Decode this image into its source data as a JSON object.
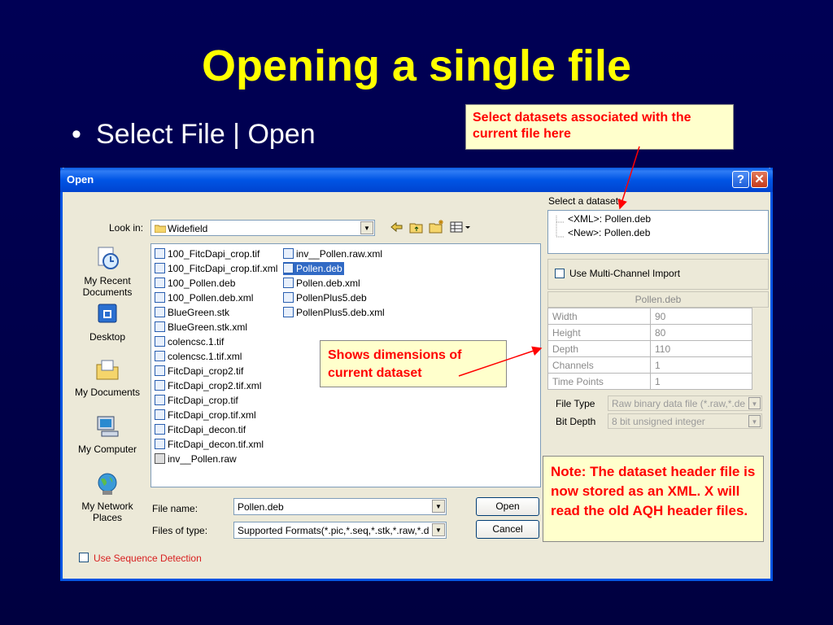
{
  "slide": {
    "title": "Opening a single file",
    "bullet": "Select File | Open"
  },
  "callouts": {
    "select_datasets": "Select datasets associated with the current file here",
    "dimensions": "Shows dimensions of current dataset",
    "note": "Note: The dataset header file is  now stored as an XML.  X will read the old AQH header files."
  },
  "dialog": {
    "title": "Open",
    "help_button": "?",
    "close_button": "✕",
    "look_in_label": "Look in:",
    "look_in_value": "Widefield",
    "places": [
      "My Recent Documents",
      "Desktop",
      "My Documents",
      "My Computer",
      "My Network Places"
    ],
    "files_col1": [
      "100_FitcDapi_crop.tif",
      "100_FitcDapi_crop.tif.xml",
      "100_Pollen.deb",
      "100_Pollen.deb.xml",
      "BlueGreen.stk",
      "BlueGreen.stk.xml",
      "colencsc.1.tif",
      "colencsc.1.tif.xml",
      "FitcDapi_crop2.tif",
      "FitcDapi_crop2.tif.xml",
      "FitcDapi_crop.tif",
      "FitcDapi_crop.tif.xml",
      "FitcDapi_decon.tif",
      "FitcDapi_decon.tif.xml",
      "inv__Pollen.raw"
    ],
    "files_col2": [
      "inv__Pollen.raw.xml",
      "Pollen.deb",
      "Pollen.deb.xml",
      "PollenPlus5.deb",
      "PollenPlus5.deb.xml"
    ],
    "selected_file": "Pollen.deb",
    "file_name_label": "File name:",
    "file_name_value": "Pollen.deb",
    "files_of_type_label": "Files of type:",
    "files_of_type_value": "Supported Formats(*.pic,*.seq,*.stk,*.raw,*.deb,",
    "open_button": "Open",
    "cancel_button": "Cancel",
    "sequence_detection": "Use Sequence Detection",
    "select_dataset_label": "Select a dataset:",
    "datasets": [
      "<XML>: Pollen.deb",
      "<New>: Pollen.deb"
    ],
    "multichannel": "Use Multi-Channel Import",
    "dataset_header": "Pollen.deb",
    "props": [
      {
        "name": "Width",
        "value": "90"
      },
      {
        "name": "Height",
        "value": "80"
      },
      {
        "name": "Depth",
        "value": "110"
      },
      {
        "name": "Channels",
        "value": "1"
      },
      {
        "name": "Time Points",
        "value": "1"
      }
    ],
    "file_type_label": "File Type",
    "file_type_value": "Raw binary data file (*.raw,*.deb,",
    "bit_depth_label": "Bit Depth",
    "bit_depth_value": "8 bit unsigned integer"
  },
  "colors": {
    "background": "#000055",
    "title": "#ffff00",
    "callout_bg": "#ffffcc",
    "callout_text": "#ff0000",
    "titlebar": "#0054e3",
    "dialog_bg": "#ece9d8",
    "selection": "#316ac5"
  }
}
